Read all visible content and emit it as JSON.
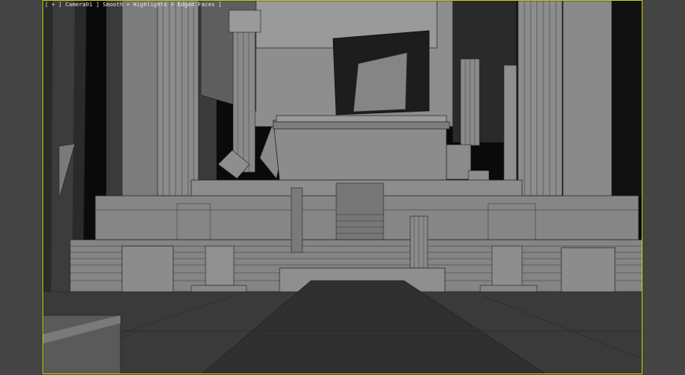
{
  "viewport": {
    "label_open": "[",
    "label_plus": "+",
    "label_close": "]",
    "camera": "Camera01",
    "shading": "Smooth + Highlights + Edged Faces",
    "label_end": "]"
  },
  "colors": {
    "frame_bg": "#444444",
    "active_border": "#c8c800",
    "label_text": "#e6e6e6"
  }
}
